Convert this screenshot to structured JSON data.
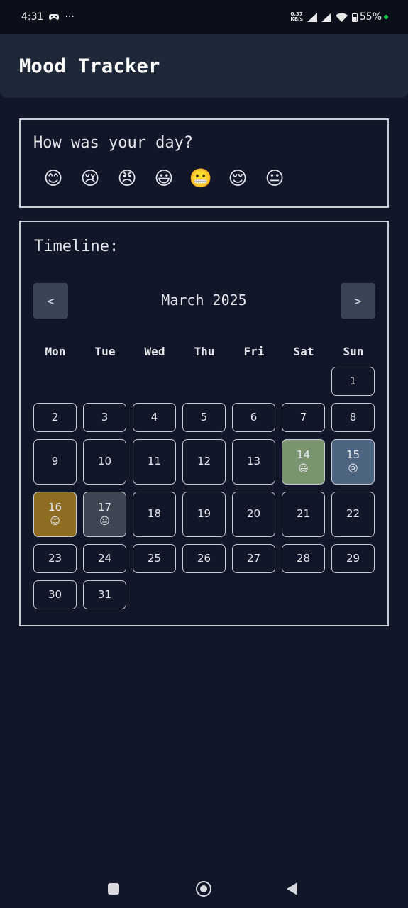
{
  "status_bar": {
    "time": "4:31",
    "dots": "···",
    "net_speed_value": "0.37",
    "net_speed_unit": "KB/s",
    "battery": "55%"
  },
  "app": {
    "title": "Mood Tracker"
  },
  "mood_card": {
    "question": "How was your day?",
    "moods": [
      "😊",
      "😢",
      "😠",
      "😃",
      "😬",
      "😌",
      "😐"
    ]
  },
  "timeline": {
    "title": "Timeline:",
    "prev_label": "<",
    "next_label": ">",
    "month": "March 2025",
    "weekdays": [
      "Mon",
      "Tue",
      "Wed",
      "Thu",
      "Fri",
      "Sat",
      "Sun"
    ],
    "first_weekday_index": 6,
    "days_in_month": 31,
    "entries": [
      {
        "day": 14,
        "mood": "😃",
        "color": "#7a9470"
      },
      {
        "day": 15,
        "mood": "😢",
        "color": "#4d6580"
      },
      {
        "day": 16,
        "mood": "😊",
        "color": "#8e6c22"
      },
      {
        "day": 17,
        "mood": "😐",
        "color": "#3f4553"
      }
    ]
  },
  "colors": {
    "background": "#111628",
    "header": "#1e2838",
    "border": "#c8cbd3",
    "button": "#394456"
  }
}
